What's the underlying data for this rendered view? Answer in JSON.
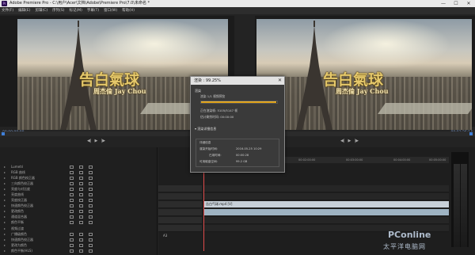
{
  "window": {
    "title": "Adobe Premiere Pro - C:\\用户\\Acer\\文档\\Adobe\\Premiere Pro\\7.0\\未命名 *",
    "minimize": "—",
    "maximize": "☐",
    "close": "✕"
  },
  "menu": [
    "文件(F)",
    "编辑(E)",
    "剪辑(C)",
    "序列(S)",
    "标记(M)",
    "字幕(T)",
    "窗口(W)",
    "帮助(H)"
  ],
  "source_monitor": {
    "logo_main": "告白氣球",
    "logo_sub": "周杰倫 Jay Chou",
    "timecode": "00:00:00:00"
  },
  "program_monitor": {
    "logo_main": "告白氣球",
    "logo_sub": "周杰倫 Jay Chou",
    "timecode": "00:03:26:14"
  },
  "effects_panel": {
    "items": [
      "Lumetri",
      "RGB 曲线",
      "RGB 颜色校正器",
      "三向颜色校正器",
      "亮度与对比度",
      "亮度曲线",
      "亮度校正器",
      "快速颜色校正器",
      "更改颜色",
      "通道混合器",
      "颜色平衡",
      "视频过渡",
      "广播级颜色",
      "快速颜色校正器",
      "更改为颜色",
      "颜色平衡(HLS)"
    ]
  },
  "timeline": {
    "ruler_ticks": [
      "00:00",
      "00:01:00:00",
      "00:02:00:00",
      "00:03:00:00",
      "00:04:00:00",
      "00:05:00:00"
    ],
    "clip_label": "告白气球.mp4 [V]",
    "track_labels": [
      "V3",
      "V2",
      "V1",
      "A1",
      "A2",
      "A3"
    ]
  },
  "dialog": {
    "title": "渲染 : 99.25%",
    "section_render": "渲染",
    "rendering_label": "渲染 1/1 视频预览",
    "progress_percent": 99.25,
    "frame_line": "正在渲染帧: 5105/5147 帧",
    "time_line": "估计剩余时间: 00:00:00",
    "details_toggle": "渲染详细信息",
    "details_heading": "详细信息",
    "start_time_label": "渲染开始时间:",
    "start_time_value": "2016-05-25 10:29",
    "elapsed_label": "已用时间:",
    "elapsed_value": "00:00:28",
    "disk_label": "可用磁盘空间:",
    "disk_value": "99.2 GB"
  },
  "watermark": {
    "brand": "PConline",
    "chinese": "太平洋电脑网"
  },
  "colors": {
    "progress": "#f0b020",
    "timecode": "#7f9fd1",
    "playhead": "#e04a4a"
  }
}
